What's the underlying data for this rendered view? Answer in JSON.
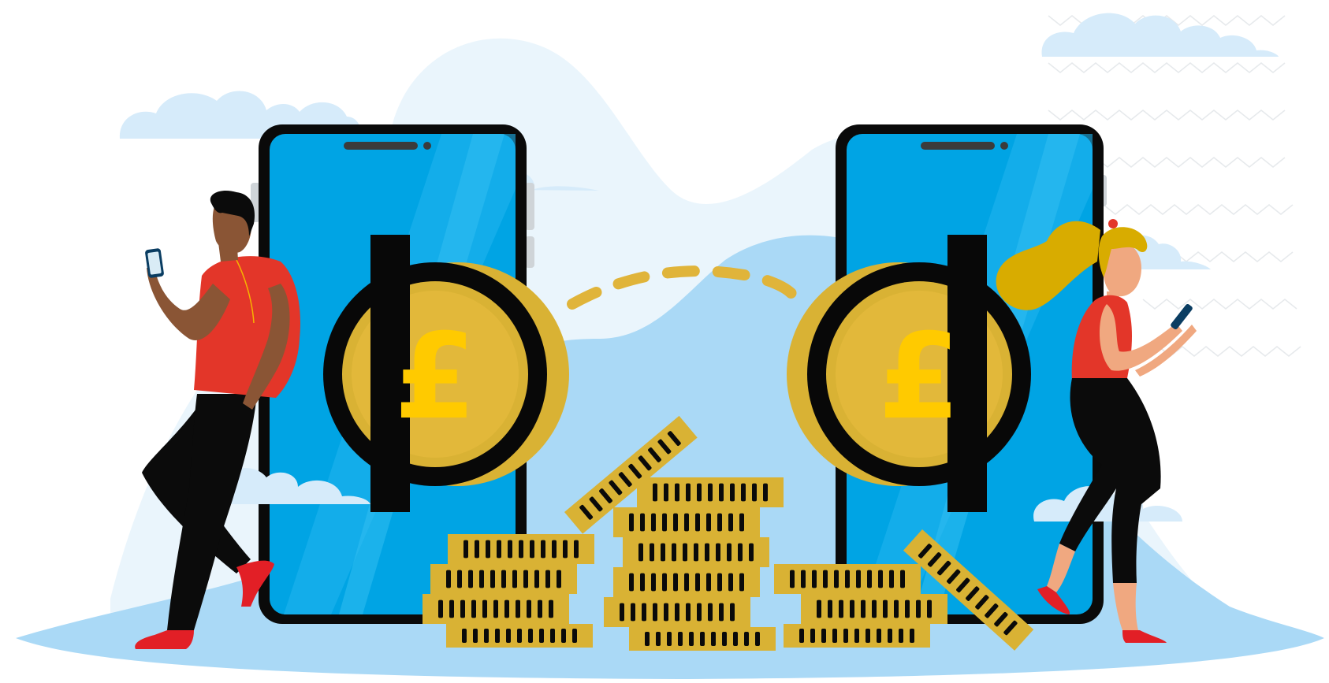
{
  "scene": {
    "description_label": "",
    "colors": {
      "background": "#ffffff",
      "sky_blob_light": "#eaf5fc",
      "ground_blue": "#aad9f6",
      "cloud": "#d6ebfa",
      "phone_body": "#0a0a0a",
      "phone_screen": "#00a4e4",
      "screen_shine": "#1fb4ee",
      "coin_gold": "#d9b234",
      "coin_gold_dark": "#c49a1d",
      "coin_inner": "#ffca00",
      "coin_black": "#080808",
      "shirt_red": "#e33629",
      "trousers_black": "#0b0b0b",
      "skin_dark": "#8a5535",
      "skin_light": "#f0a880",
      "hair_blonde": "#d8ac00",
      "shoe_red": "#e21f26",
      "dash_gold": "#e0b43a"
    },
    "coin_symbol_left": "£",
    "coin_symbol_right": "£",
    "icons": {
      "left_phone": "smartphone-icon",
      "right_phone": "smartphone-icon",
      "left_coin": "pound-coin-icon",
      "right_coin": "pound-coin-icon",
      "transfer_path": "dashed-transfer-arc-icon",
      "coin_stacks": "coin-stack-icon",
      "man": "person-with-phone-icon",
      "woman": "person-with-phone-icon"
    }
  }
}
